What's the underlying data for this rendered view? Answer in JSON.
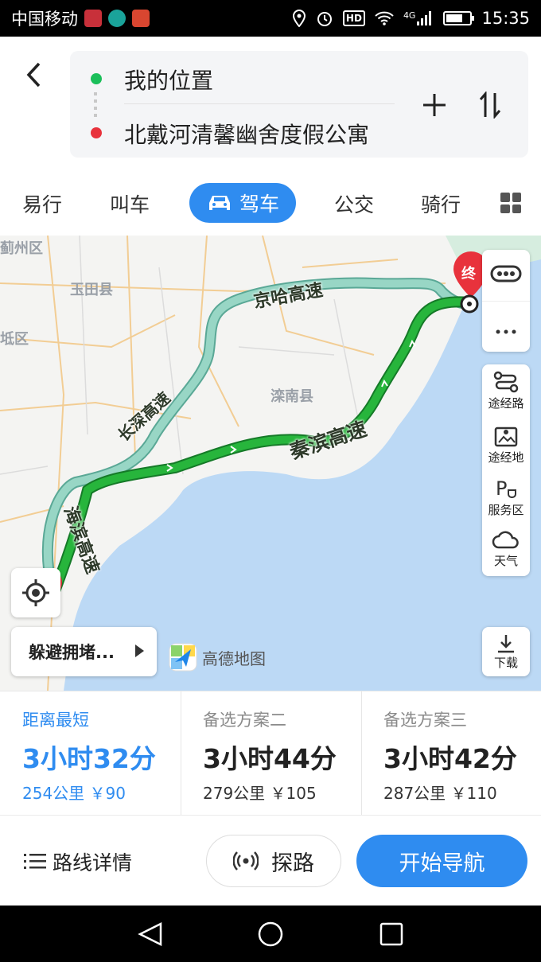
{
  "status_bar": {
    "carrier": "中国移动",
    "network": "4G",
    "hd": "HD",
    "time": "15:35",
    "battery_percent": 70
  },
  "route": {
    "origin": "我的位置",
    "destination": "北戴河清馨幽舍度假公寓",
    "origin_color": "#1bbf5a",
    "destination_color": "#e8323c"
  },
  "tabs": {
    "items": [
      "易行",
      "叫车",
      "驾车",
      "公交",
      "骑行"
    ],
    "active": "驾车"
  },
  "map": {
    "place_labels": [
      "蓟州区",
      "玉田县",
      "坻区",
      "滦南县"
    ],
    "roads": {
      "jingha": "京哈高速",
      "changshen": "长深高速",
      "qinbin": "秦滨高速",
      "haibin": "海滨高速"
    },
    "destination_marker": "终",
    "side_tools": [
      "途经路",
      "途经地",
      "服务区",
      "天气"
    ],
    "avoid_label": "躲避拥堵...",
    "logo_text": "高德地图",
    "download_label": "下载",
    "colors": {
      "selected_route": "#27b53c",
      "alternate_route": "#8fcfbf",
      "sea": "#bcd9f5",
      "land": "#f4f4f2"
    }
  },
  "options": [
    {
      "name": "距离最短",
      "time": "3小时32分",
      "distance": "254公里",
      "cost": "￥90",
      "active": true
    },
    {
      "name": "备选方案二",
      "time": "3小时44分",
      "distance": "279公里",
      "cost": "￥105",
      "active": false
    },
    {
      "name": "备选方案三",
      "time": "3小时42分",
      "distance": "287公里",
      "cost": "￥110",
      "active": false
    }
  ],
  "actions": {
    "details": "路线详情",
    "explore": "探路",
    "start_navigation": "开始导航"
  }
}
